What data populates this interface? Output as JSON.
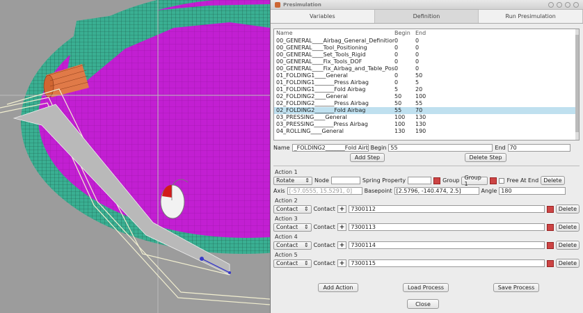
{
  "window": {
    "title": "Presimulation"
  },
  "tabs": [
    "Variables",
    "Definition",
    "Run Presimulation"
  ],
  "list": {
    "headers": [
      "Name",
      "Begin",
      "End"
    ],
    "rows": [
      [
        "00_GENERAL____Airbag_General_Definitions",
        "0",
        "0"
      ],
      [
        "00_GENERAL____Tool_Positioning",
        "0",
        "0"
      ],
      [
        "00_GENERAL____Set_Tools_Rigid",
        "0",
        "0"
      ],
      [
        "00_GENERAL____Fix_Tools_DOF",
        "0",
        "0"
      ],
      [
        "00_GENERAL____Fix_Airbag_and_Table_Posi...",
        "0",
        "0"
      ],
      [
        "01_FOLDING1____General",
        "0",
        "50"
      ],
      [
        "01_FOLDING1_______Press Airbag",
        "0",
        "5"
      ],
      [
        "01_FOLDING1_______Fold Airbag",
        "5",
        "20"
      ],
      [
        "02_FOLDING2____General",
        "50",
        "100"
      ],
      [
        "02_FOLDING2_______Press Airbag",
        "50",
        "55"
      ],
      [
        "02_FOLDING2_______Fold Airbag",
        "55",
        "70"
      ],
      [
        "03_PRESSING____General",
        "100",
        "130"
      ],
      [
        "03_PRESSING_______Press Airbag",
        "100",
        "130"
      ],
      [
        "04_ROLLING____General",
        "130",
        "190"
      ]
    ],
    "selected_index": 10
  },
  "step": {
    "name_label": "Name",
    "name_value": "_FOLDING2_______Fold Airbag",
    "begin_label": "Begin",
    "begin_value": "55",
    "end_label": "End",
    "end_value": "70",
    "add_step": "Add Step",
    "delete_step": "Delete Step"
  },
  "action1": {
    "label": "Action 1",
    "type": "Rotate",
    "node_label": "Node",
    "node_value": "",
    "spring_label": "Spring Property",
    "spring_value": "",
    "group_label": "Group",
    "group_value": "Group 1",
    "free_at_end_label": "Free At End",
    "delete_label": "Delete",
    "axis_label": "Axis",
    "axis_value": "[-57.0555, 15.5291, 0]",
    "basepoint_label": "Basepoint",
    "basepoint_value": "[2.5796, -140.474, 2.5]",
    "angle_label": "Angle",
    "angle_value": "180"
  },
  "contact_actions": [
    {
      "label": "Action 2",
      "type": "Contact",
      "contact_label": "Contact",
      "value": "7300112",
      "delete_label": "Delete"
    },
    {
      "label": "Action 3",
      "type": "Contact",
      "contact_label": "Contact",
      "value": "7300113",
      "delete_label": "Delete"
    },
    {
      "label": "Action 4",
      "type": "Contact",
      "contact_label": "Contact",
      "value": "7300114",
      "delete_label": "Delete"
    },
    {
      "label": "Action 5",
      "type": "Contact",
      "contact_label": "Contact",
      "value": "7300115",
      "delete_label": "Delete"
    }
  ],
  "buttons": {
    "add_action": "Add Action",
    "load_process": "Load Process",
    "save_process": "Save Process",
    "close": "Close"
  },
  "colors": {
    "airbag": "#cc1ed6",
    "mesh_ring": "#38a88e",
    "tube": "#e07040",
    "background": "#9c9c9c",
    "selection": "#bfe0ef"
  },
  "icons": {
    "app": "presim-app-icon",
    "mouse": "mouse-pointer-icon"
  }
}
